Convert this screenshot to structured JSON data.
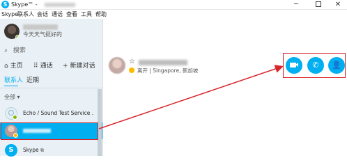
{
  "window": {
    "title": "Skype™ - ",
    "controls": [
      "─",
      "□",
      "✕"
    ]
  },
  "menu": [
    "Skype",
    "联系人",
    "会话",
    "通话",
    "查看",
    "工具",
    "帮助"
  ],
  "me": {
    "mood": "今天天气挺好的"
  },
  "search": {
    "icon": "search-icon",
    "placeholder": "搜索"
  },
  "nav": {
    "home": "主页",
    "call": "通话",
    "new_chat": "新建对话"
  },
  "tabs": {
    "contacts": "联系人",
    "recent": "近期"
  },
  "filter": "全部",
  "contacts": [
    {
      "name": "Echo / Sound Test Service ."
    },
    {
      "name": ""
    },
    {
      "name": "Skype"
    }
  ],
  "profile": {
    "status_text": "离开 | Singapore, 新加坡"
  },
  "actions": {
    "video_icon": "video-call-icon",
    "call_icon": "phone-icon",
    "add_icon": "add-contact-icon"
  },
  "colors": {
    "accent": "#00aff0",
    "highlight": "#d9252a",
    "away": "#ffb900",
    "online": "#7fba00"
  }
}
